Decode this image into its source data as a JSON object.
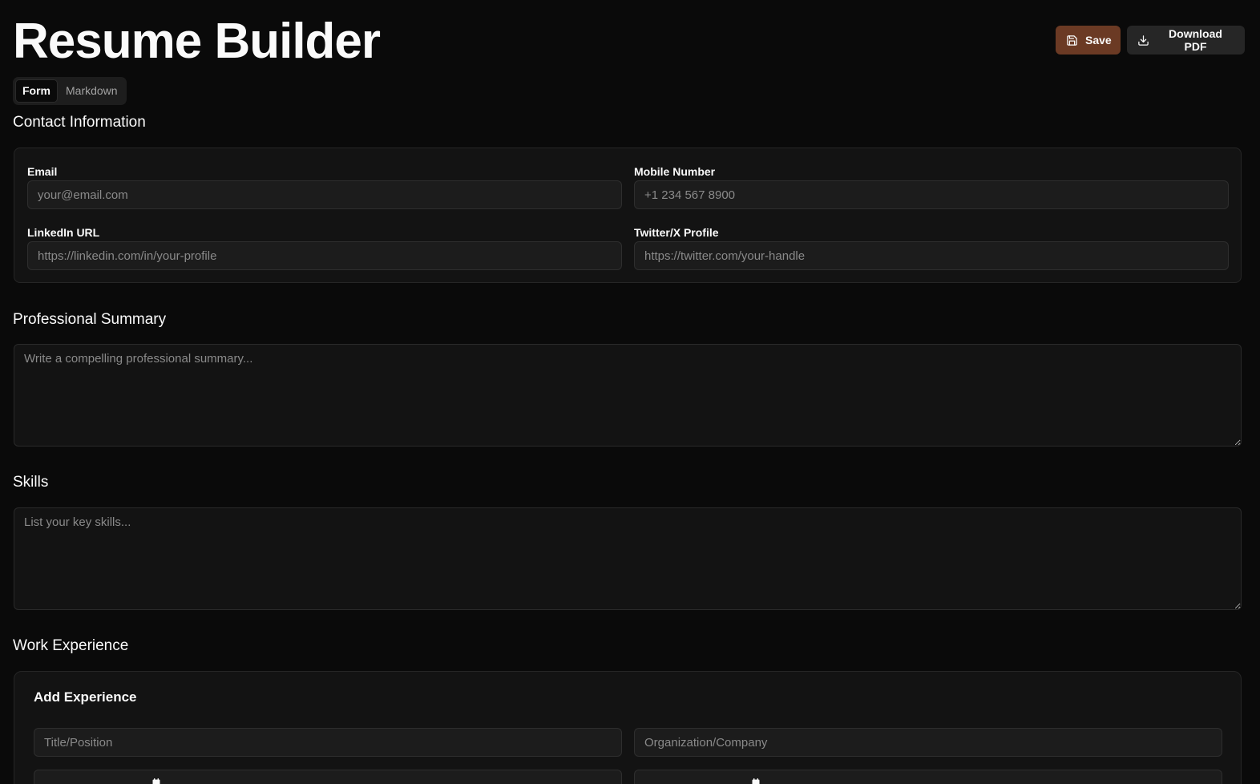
{
  "header": {
    "title": "Resume Builder",
    "save_label": "Save",
    "download_label": "Download PDF"
  },
  "tabs": [
    {
      "label": "Form",
      "active": true
    },
    {
      "label": "Markdown",
      "active": false
    }
  ],
  "contact": {
    "title": "Contact Information",
    "email_label": "Email",
    "email_placeholder": "your@email.com",
    "mobile_label": "Mobile Number",
    "mobile_placeholder": "+1 234 567 8900",
    "linkedin_label": "LinkedIn URL",
    "linkedin_placeholder": "https://linkedin.com/in/your-profile",
    "twitter_label": "Twitter/X Profile",
    "twitter_placeholder": "https://twitter.com/your-handle"
  },
  "summary": {
    "title": "Professional Summary",
    "placeholder": "Write a compelling professional summary..."
  },
  "skills": {
    "title": "Skills",
    "placeholder": "List your key skills..."
  },
  "experience": {
    "title": "Work Experience",
    "add_title": "Add Experience",
    "position_placeholder": "Title/Position",
    "company_placeholder": "Organization/Company"
  },
  "colors": {
    "background": "#0a0a0a",
    "card": "#131313",
    "accent_save": "#6b3a24",
    "secondary_button": "#262626"
  }
}
